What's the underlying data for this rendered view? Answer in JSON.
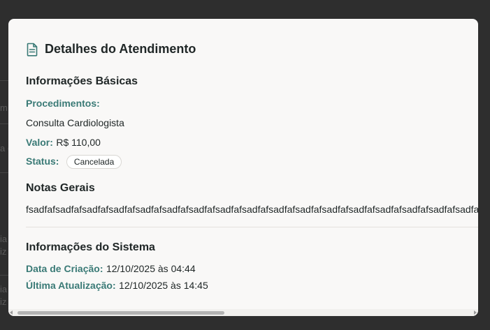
{
  "background": {
    "fragments": [
      "m",
      "a (",
      "ia",
      "iz",
      "ia",
      "iz"
    ]
  },
  "modal": {
    "title": "Detalhes do Atendimento",
    "title_icon": "document-text-icon",
    "basic_info": {
      "heading": "Informações Básicas",
      "procedures_label": "Procedimentos:",
      "procedures_value": "Consulta Cardiologista",
      "value_label": "Valor:",
      "value_value": "R$ 110,00",
      "status_label": "Status:",
      "status_value": "Cancelada"
    },
    "notes": {
      "heading": "Notas Gerais",
      "text": "fsadfafsadfafsadfafsadfafsadfafsadfafsadfafsadfafsadfafsadfafsadfafsadfafsadfafsadfafsadfafsadfafsadfafsadfafsadfafsadfafsadfafsadfafsadfafsadfafsadfafsadfafsadfafsadfafsadfafsadfafsadfa"
    },
    "system_info": {
      "heading": "Informações do Sistema",
      "created_label": "Data de Criação:",
      "created_value": "12/10/2025 às 04:44",
      "updated_label": "Última Atualização:",
      "updated_value": "12/10/2025 às 14:45"
    }
  },
  "colors": {
    "accent": "#3a7a76",
    "overlay": "#2e2e2e",
    "modal_bg": "#f9f8f7"
  }
}
